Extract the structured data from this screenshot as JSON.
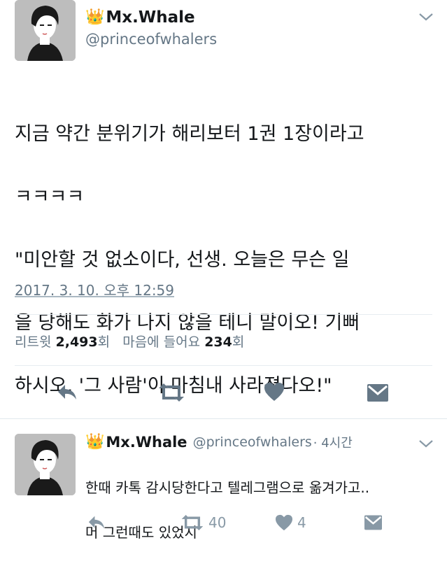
{
  "main_tweet": {
    "display_name": "Mx.Whale",
    "handle": "@princeofwhalers",
    "crown_icon": "crown-emoji",
    "text_lines": [
      "지금 약간 분위기가 해리보터 1권 1장이라고",
      "ㅋㅋㅋㅋ",
      "\"미안할 것 없소이다, 선생. 오늘은 무슨 일",
      "을 당해도 화가 나지 않을 테니 말이오! 기뻐",
      "하시오, '그 사람'이 마침내 사라졌다오!\""
    ],
    "timestamp": "2017. 3. 10. 오후 12:59",
    "retweet_label": "리트윗",
    "retweet_count": "2,493",
    "retweet_unit": "회",
    "like_label": "마음에 들어요",
    "like_count": "234",
    "like_unit": "회",
    "actions": [
      "reply-icon",
      "retweet-icon",
      "heart-icon",
      "envelope-icon"
    ]
  },
  "reply_tweet": {
    "display_name": "Mx.Whale",
    "handle": "@princeofwhalers",
    "time": "· 4시간",
    "text_lines": [
      "한때 카톡 감시당한다고 텔레그램으로 옮겨가고..",
      "머 그런때도 있었지"
    ],
    "retweet_count": "40",
    "like_count": "4"
  },
  "colors": {
    "text": "#14171a",
    "secondary": "#657786",
    "icon": "#657786",
    "divider": "#e6ecf0"
  }
}
